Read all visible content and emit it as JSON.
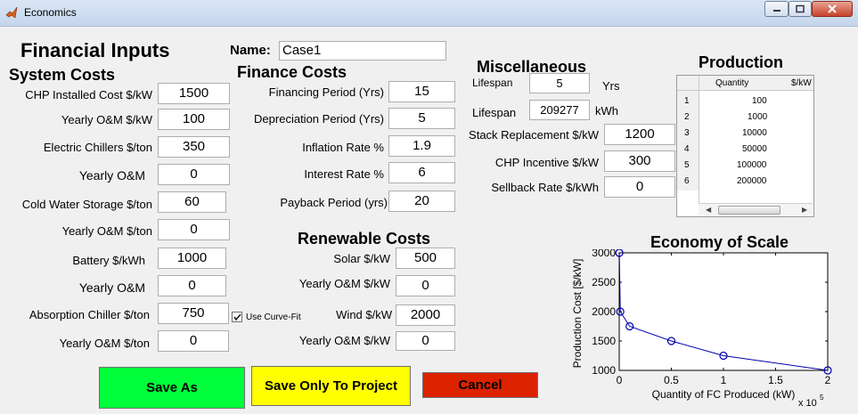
{
  "window": {
    "title": "Economics"
  },
  "headings": {
    "financial_inputs": "Financial Inputs",
    "system_costs": "System Costs",
    "finance_costs": "Finance Costs",
    "miscellaneous": "Miscellaneous",
    "production": "Production",
    "renewable_costs": "Renewable Costs",
    "economy_of_scale": "Economy of Scale"
  },
  "name": {
    "label": "Name:",
    "value": "Case1"
  },
  "system_costs": [
    {
      "label": "CHP Installed Cost $/kW",
      "value": "1500"
    },
    {
      "label": "Yearly O&M $/kW",
      "value": "100"
    },
    {
      "label": "Electric Chillers $/ton",
      "value": "350"
    },
    {
      "label": "Yearly O&M",
      "value": "0"
    },
    {
      "label": "Cold Water Storage $/ton",
      "value": "60"
    },
    {
      "label": "Yearly O&M $/ton",
      "value": "0"
    },
    {
      "label": "Battery $/kWh",
      "value": "1000"
    },
    {
      "label": "Yearly O&M",
      "value": "0"
    },
    {
      "label": "Absorption Chiller $/ton",
      "value": "750"
    },
    {
      "label": "Yearly O&M $/ton",
      "value": "0"
    }
  ],
  "curve_fit": {
    "label": "Use Curve-Fit",
    "checked": true
  },
  "finance_costs": [
    {
      "label": "Financing Period (Yrs)",
      "value": "15"
    },
    {
      "label": "Depreciation Period (Yrs)",
      "value": "5"
    },
    {
      "label": "Inflation Rate %",
      "value": "1.9"
    },
    {
      "label": "Interest Rate %",
      "value": "6"
    },
    {
      "label": "Payback Period (yrs)",
      "value": "20"
    }
  ],
  "renewable_costs": [
    {
      "label": "Solar $/kW",
      "value": "500"
    },
    {
      "label": "Yearly O&M $/kW",
      "value": "0"
    },
    {
      "label": "Wind $/kW",
      "value": "2000"
    },
    {
      "label": "Yearly O&M $/kW",
      "value": "0"
    }
  ],
  "miscellaneous": {
    "lifespan_years": {
      "label": "Lifespan",
      "value": "5",
      "unit": "Yrs"
    },
    "lifespan_kwh": {
      "label": "Lifespan",
      "value": "209277",
      "unit": "kWh"
    },
    "stack_replacement": {
      "label": "Stack Replacement $/kW",
      "value": "1200"
    },
    "chp_incentive": {
      "label": "CHP Incentive $/kW",
      "value": "300"
    },
    "sellback_rate": {
      "label": "Sellback Rate $/kWh",
      "value": "0"
    }
  },
  "production_table": {
    "columns": [
      "Quantity",
      "$/kW"
    ],
    "rows": [
      {
        "index": "1",
        "quantity": "100"
      },
      {
        "index": "2",
        "quantity": "1000"
      },
      {
        "index": "3",
        "quantity": "10000"
      },
      {
        "index": "4",
        "quantity": "50000"
      },
      {
        "index": "5",
        "quantity": "100000"
      },
      {
        "index": "6",
        "quantity": "200000"
      }
    ]
  },
  "buttons": {
    "save_as": "Save As",
    "save_project": "Save Only To Project",
    "cancel": "Cancel"
  },
  "colors": {
    "save_as": "#00ff3a",
    "save_project": "#ffff00",
    "cancel": "#dd2200",
    "plot_line": "#0000aa"
  },
  "chart_data": {
    "type": "line",
    "title": "Economy of Scale",
    "xlabel": "Quantity of FC Produced (kW)",
    "ylabel": "Production Cost [$/kW]",
    "x_exponent_label": "x 10",
    "x_exponent_power": "5",
    "xlim": [
      0,
      200000
    ],
    "ylim": [
      1000,
      3000
    ],
    "x_ticks": [
      "0",
      "0.5",
      "1",
      "1.5",
      "2"
    ],
    "x_tick_values": [
      0,
      50000,
      100000,
      150000,
      200000
    ],
    "y_ticks": [
      "1000",
      "1500",
      "2000",
      "2500",
      "3000"
    ],
    "y_tick_values": [
      1000,
      1500,
      2000,
      2500,
      3000
    ],
    "series": [
      {
        "x": [
          100,
          1000,
          10000,
          50000,
          100000,
          200000
        ],
        "y": [
          3000,
          2000,
          1750,
          1500,
          1250,
          1000
        ]
      }
    ]
  }
}
